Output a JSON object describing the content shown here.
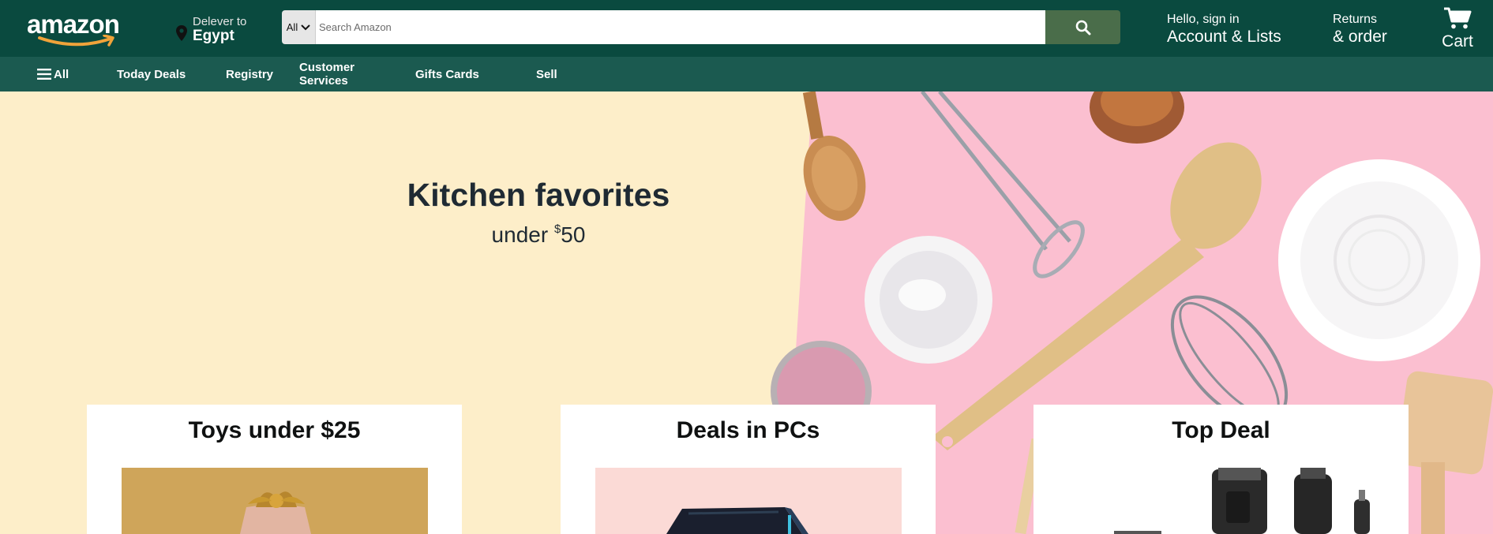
{
  "header": {
    "logo_text": "amazon",
    "deliver_line1": "Delever to",
    "deliver_line2": "Egypt",
    "search_category": "All",
    "search_placeholder": "Search Amazon",
    "account_line1": "Hello, sign in",
    "account_line2": "Account & Lists",
    "returns_line1": "Returns",
    "returns_line2": "& order",
    "cart_label": "Cart"
  },
  "nav": {
    "all_label": "All",
    "items": [
      {
        "label": "Today Deals"
      },
      {
        "label": "Registry"
      },
      {
        "label": "Customer Services"
      },
      {
        "label": "Gifts Cards"
      },
      {
        "label": "Sell"
      }
    ]
  },
  "hero": {
    "title": "Kitchen favorites",
    "subtitle_prefix": "under ",
    "subtitle_currency": "$",
    "subtitle_amount": "50"
  },
  "cards": [
    {
      "title": "Toys under $25"
    },
    {
      "title": "Deals in PCs"
    },
    {
      "title": "Top Deal"
    }
  ],
  "colors": {
    "header_bg": "#0a4a3f",
    "nav_bg": "#1b5a50",
    "search_button": "#4a6d4a",
    "hero_left_bg": "#fdeec9",
    "hero_right_bg": "#fbbfd0",
    "logo_smile": "#f0a33a"
  },
  "icons": [
    "map-pin-icon",
    "chevron-down-icon",
    "search-icon",
    "cart-icon",
    "hamburger-icon"
  ]
}
